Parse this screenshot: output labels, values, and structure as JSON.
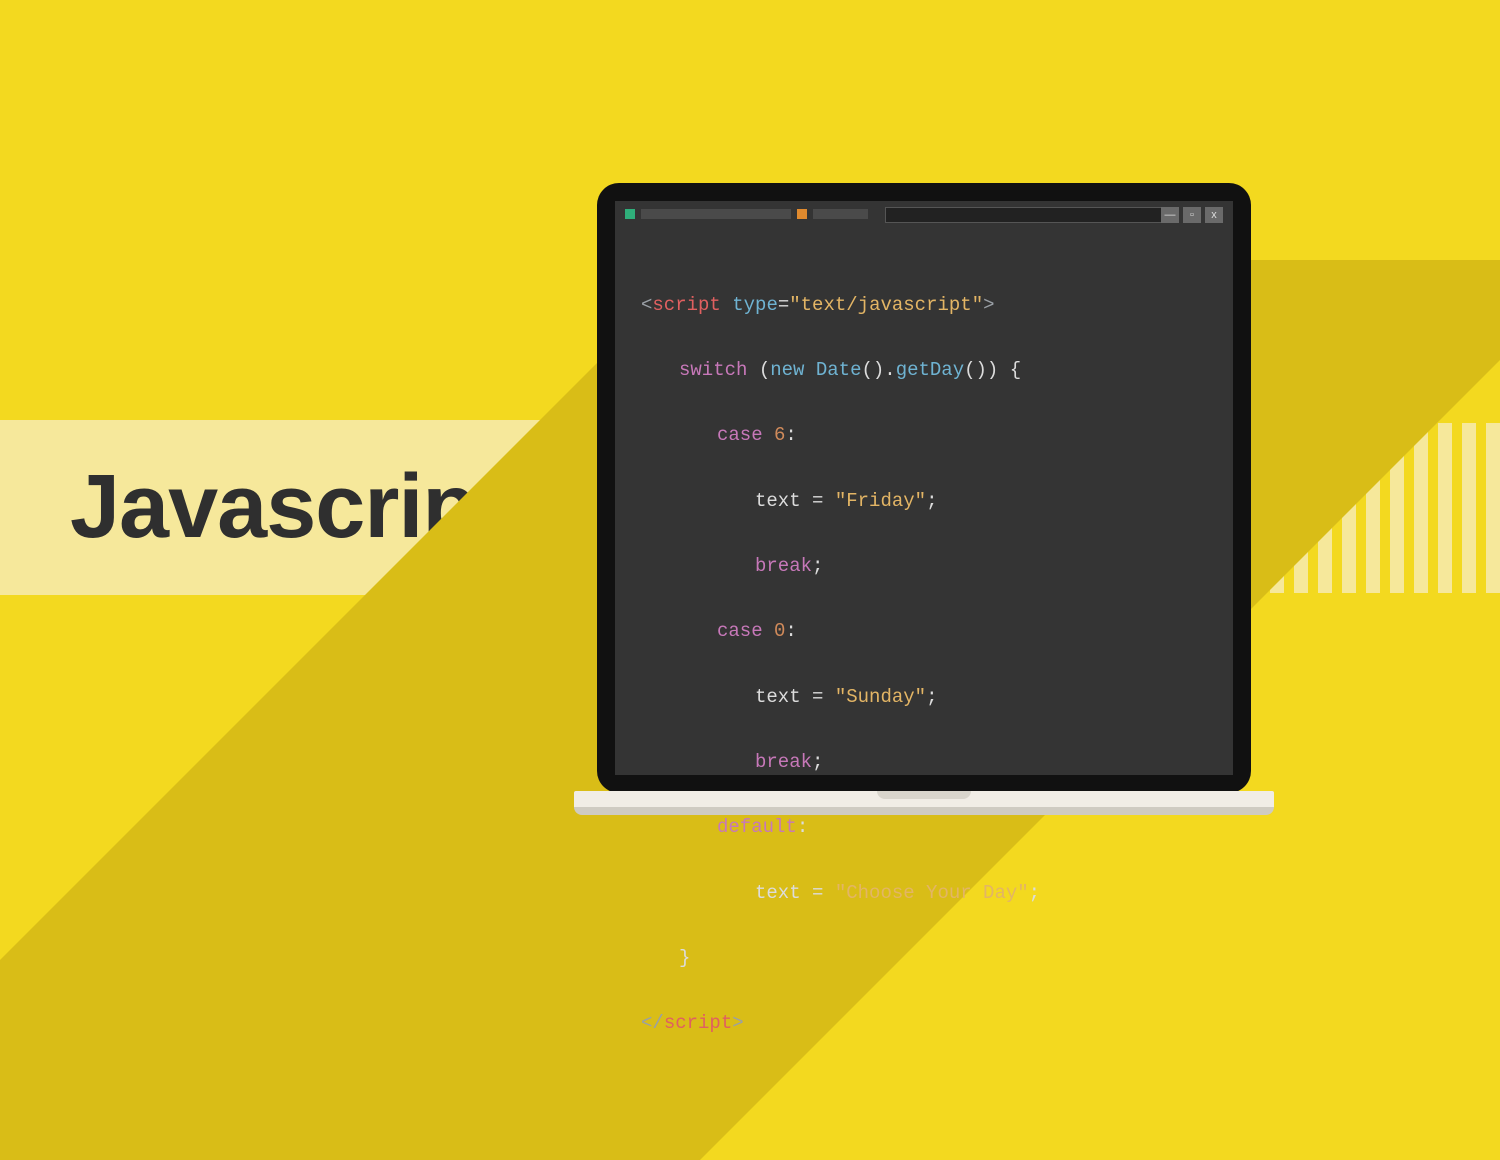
{
  "title": "Javascript",
  "window_controls": {
    "minimize": "—",
    "maximize": "▫",
    "close": "x"
  },
  "code": {
    "open_br": "<",
    "close_br": ">",
    "slash": "/",
    "script_tag": "script",
    "type_attr": "type",
    "eq": "=",
    "quote": "\"",
    "mime": "text/javascript",
    "switch_kw": "switch",
    "new_kw": "new",
    "date_fn": "Date",
    "getday_fn": "getDay",
    "parens_open": "(",
    "parens_close": ")",
    "dot": ".",
    "brace_open": "{",
    "brace_close": "}",
    "case_kw": "case",
    "case1_num": "6",
    "case2_num": "0",
    "colon": ":",
    "text_var": "text",
    "assign": " = ",
    "friday": "Friday",
    "sunday": "Sunday",
    "choose": "Choose Your Day",
    "semi": ";",
    "break_kw": "break",
    "default_kw": "default"
  }
}
